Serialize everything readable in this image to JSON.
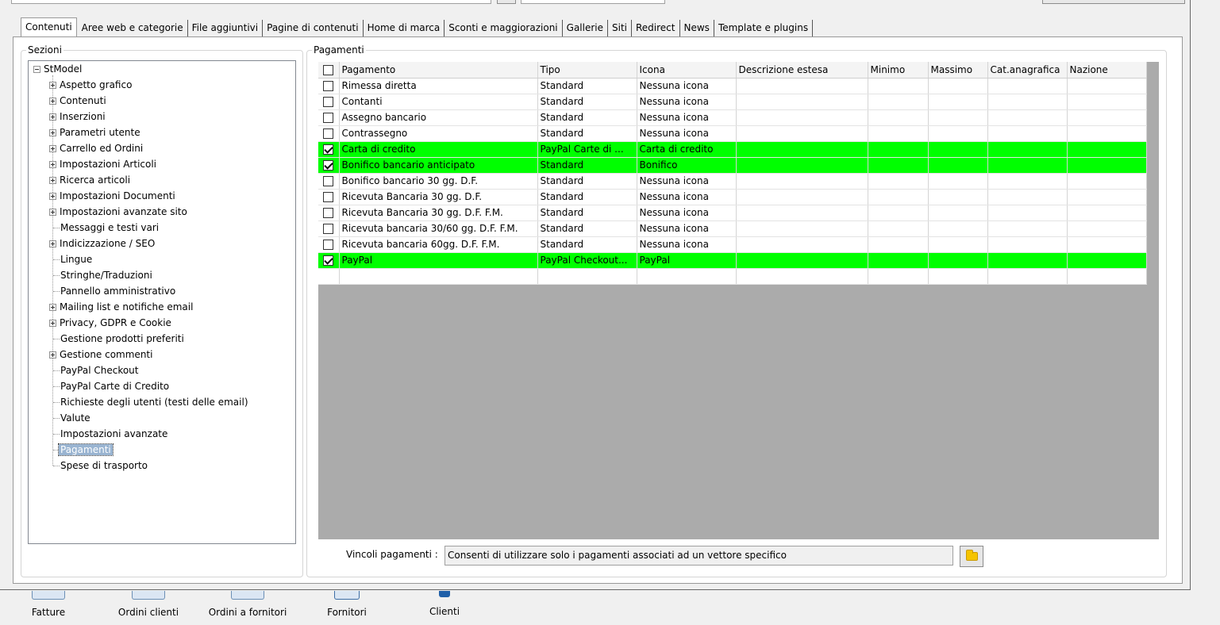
{
  "tabs": [
    {
      "label": "Contenuti",
      "active": true
    },
    {
      "label": "Aree web e categorie"
    },
    {
      "label": "File aggiuntivi"
    },
    {
      "label": "Pagine di contenuti"
    },
    {
      "label": "Home di marca"
    },
    {
      "label": "Sconti e maggiorazioni"
    },
    {
      "label": "Gallerie"
    },
    {
      "label": "Siti"
    },
    {
      "label": "Redirect"
    },
    {
      "label": "News"
    },
    {
      "label": "Template e plugins"
    }
  ],
  "sections": {
    "title": "Sezioni",
    "root": "StModel",
    "items": [
      {
        "label": "Aspetto grafico",
        "expandable": true
      },
      {
        "label": "Contenuti",
        "expandable": true
      },
      {
        "label": "Inserzioni",
        "expandable": true
      },
      {
        "label": "Parametri utente",
        "expandable": true
      },
      {
        "label": "Carrello ed Ordini",
        "expandable": true
      },
      {
        "label": "Impostazioni Articoli",
        "expandable": true
      },
      {
        "label": "Ricerca articoli",
        "expandable": true
      },
      {
        "label": "Impostazioni Documenti",
        "expandable": true
      },
      {
        "label": "Impostazioni avanzate sito",
        "expandable": true
      },
      {
        "label": "Messaggi e testi vari",
        "expandable": false
      },
      {
        "label": "Indicizzazione / SEO",
        "expandable": true
      },
      {
        "label": "Lingue",
        "expandable": false
      },
      {
        "label": "Stringhe/Traduzioni",
        "expandable": false
      },
      {
        "label": "Pannello amministrativo",
        "expandable": false
      },
      {
        "label": "Mailing list e notifiche email",
        "expandable": true
      },
      {
        "label": "Privacy, GDPR e Cookie",
        "expandable": true
      },
      {
        "label": "Gestione prodotti preferiti",
        "expandable": false
      },
      {
        "label": "Gestione commenti",
        "expandable": true
      },
      {
        "label": "PayPal Checkout",
        "expandable": false
      },
      {
        "label": "PayPal Carte di Credito",
        "expandable": false
      },
      {
        "label": "Richieste degli utenti (testi delle email)",
        "expandable": false
      },
      {
        "label": "Valute",
        "expandable": false
      },
      {
        "label": "Impostazioni avanzate",
        "expandable": false
      },
      {
        "label": "Pagamenti",
        "expandable": false,
        "selected": true
      },
      {
        "label": "Spese di trasporto",
        "expandable": false
      }
    ]
  },
  "payments": {
    "title": "Pagamenti",
    "columns": [
      "Pagamento",
      "Tipo",
      "Icona",
      "Descrizione estesa",
      "Minimo",
      "Massimo",
      "Cat.anagrafica",
      "Nazione"
    ],
    "rows": [
      {
        "checked": false,
        "highlight": false,
        "cells": [
          "Rimessa diretta",
          "Standard",
          "Nessuna icona",
          "",
          "",
          "",
          "",
          ""
        ]
      },
      {
        "checked": false,
        "highlight": false,
        "cells": [
          "Contanti",
          "Standard",
          "Nessuna icona",
          "",
          "",
          "",
          "",
          ""
        ]
      },
      {
        "checked": false,
        "highlight": false,
        "cells": [
          "Assegno bancario",
          "Standard",
          "Nessuna icona",
          "",
          "",
          "",
          "",
          ""
        ]
      },
      {
        "checked": false,
        "highlight": false,
        "cells": [
          "Contrassegno",
          "Standard",
          "Nessuna icona",
          "",
          "",
          "",
          "",
          ""
        ]
      },
      {
        "checked": true,
        "highlight": true,
        "cells": [
          "Carta di credito",
          "PayPal Carte di ...",
          "Carta di credito",
          "",
          "",
          "",
          "",
          ""
        ]
      },
      {
        "checked": true,
        "highlight": true,
        "cells": [
          "Bonifico bancario anticipato",
          "Standard",
          "Bonifico",
          "",
          "",
          "",
          "",
          ""
        ]
      },
      {
        "checked": false,
        "highlight": false,
        "cells": [
          "Bonifico bancario 30 gg. D.F.",
          "Standard",
          "Nessuna icona",
          "",
          "",
          "",
          "",
          ""
        ]
      },
      {
        "checked": false,
        "highlight": false,
        "cells": [
          "Ricevuta Bancaria 30 gg. D.F.",
          "Standard",
          "Nessuna icona",
          "",
          "",
          "",
          "",
          ""
        ]
      },
      {
        "checked": false,
        "highlight": false,
        "cells": [
          "Ricevuta Bancaria 30 gg. D.F. F.M.",
          "Standard",
          "Nessuna icona",
          "",
          "",
          "",
          "",
          ""
        ]
      },
      {
        "checked": false,
        "highlight": false,
        "cells": [
          "Ricevuta bancaria 30/60 gg. D.F. F.M.",
          "Standard",
          "Nessuna icona",
          "",
          "",
          "",
          "",
          ""
        ]
      },
      {
        "checked": false,
        "highlight": false,
        "cells": [
          "Ricevuta bancaria 60gg. D.F. F.M.",
          "Standard",
          "Nessuna icona",
          "",
          "",
          "",
          "",
          ""
        ]
      },
      {
        "checked": true,
        "highlight": true,
        "cells": [
          "PayPal",
          "PayPal Checkout...",
          "PayPal",
          "",
          "",
          "",
          "",
          ""
        ]
      }
    ]
  },
  "constraints": {
    "label": "Vincoli pagamenti :",
    "value": "Consenti di utilizzare solo i pagamenti associati ad un vettore specifico"
  },
  "shortcuts": [
    {
      "label": "Fatture"
    },
    {
      "label": "Ordini clienti"
    },
    {
      "label": "Ordini a fornitori"
    },
    {
      "label": "Fornitori"
    },
    {
      "label": "Clienti"
    }
  ],
  "colors": {
    "highlight": "#00ff00",
    "selection": "#99b4d1",
    "grid_bg": "#ababab"
  }
}
